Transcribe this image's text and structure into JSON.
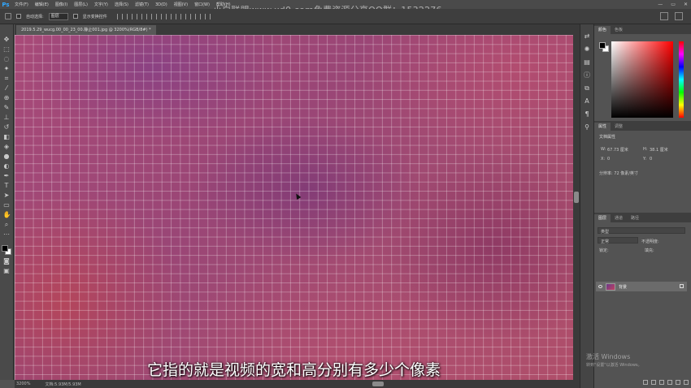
{
  "menubar": {
    "logo": "Ps",
    "items": [
      "文件(F)",
      "编辑(E)",
      "图像(I)",
      "图层(L)",
      "文字(Y)",
      "选择(S)",
      "滤镜(T)",
      "3D(D)",
      "视图(V)",
      "窗口(W)",
      "帮助(H)"
    ],
    "watermark": "小白联盟www.xd0.com免费资源分享QQ群：1532276"
  },
  "optionsbar": {
    "auto_select_label": "自动选择:",
    "auto_select_value": "图层",
    "show_transform_label": "显示变换控件"
  },
  "document": {
    "tab_title": "2019.5.29_wucg.00_00_23_00.静止001.jpg @ 3200%(RGB/8#) *",
    "subtitle": "它指的就是视频的宽和高分别有多少个像素"
  },
  "statusbar": {
    "zoom": "3200%",
    "doc_info": "文档:5.93M/5.93M"
  },
  "color_panel": {
    "tabs": [
      "颜色",
      "色板"
    ],
    "fg_color": "#000000",
    "bg_color": "#ffffff"
  },
  "properties_panel": {
    "tabs": [
      "属性",
      "调整"
    ],
    "title": "文档属性",
    "w_label": "W:",
    "w_value": "67.73 厘米",
    "h_label": "H:",
    "h_value": "38.1 厘米",
    "x_label": "X:",
    "x_value": "0",
    "y_label": "Y:",
    "y_value": "0",
    "resolution": "分辨率: 72 像素/英寸"
  },
  "layers_panel": {
    "tabs": [
      "图层",
      "通道",
      "路径"
    ],
    "kind_label": "类型",
    "blend_mode": "正常",
    "opacity_label": "不透明度:",
    "lock_label": "锁定:",
    "fill_label": "填充:",
    "layer_name": "背景"
  },
  "activation": {
    "title": "激活 Windows",
    "hint": "转到\"设置\"以激活 Windows。"
  }
}
